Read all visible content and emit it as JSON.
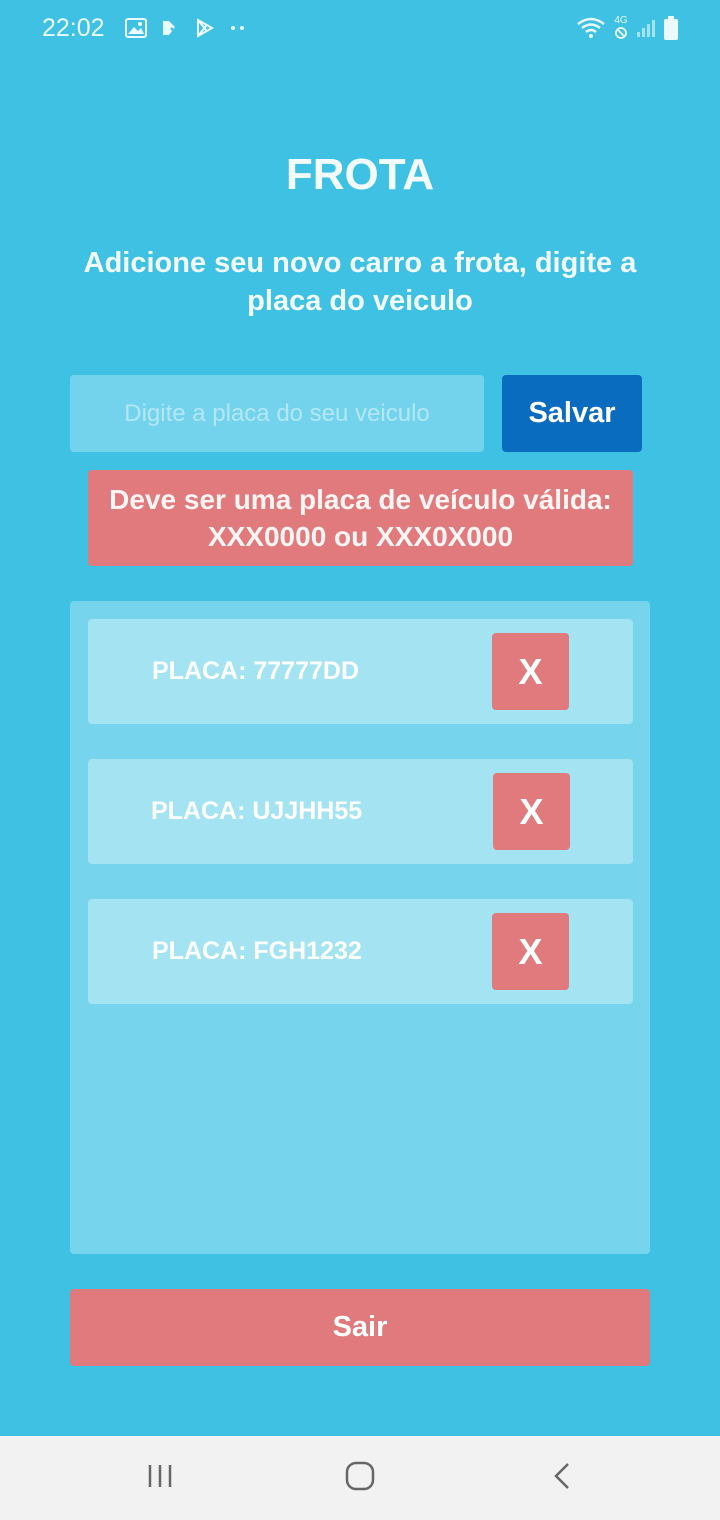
{
  "status_bar": {
    "time": "22:02",
    "left_icons": [
      "image-icon",
      "check-app-icon",
      "play-store-icon",
      "more-dots-icon"
    ],
    "right_icons": [
      "wifi-icon",
      "network-4g-icon",
      "signal-icon",
      "battery-icon"
    ],
    "network_label": "4G"
  },
  "header": {
    "title": "FROTA",
    "subtitle": "Adicione seu novo carro a frota, digite a placa do veiculo"
  },
  "form": {
    "placeholder": "Digite a placa do seu veiculo",
    "value": "",
    "save_label": "Salvar",
    "error": "Deve ser uma placa de veículo válida: XXX0000 ou XXX0X000"
  },
  "list": {
    "items": [
      {
        "label": "PLACA: 77777DD",
        "delete_label": "X"
      },
      {
        "label": "PLACA: UJJHH55",
        "delete_label": "X"
      },
      {
        "label": "PLACA: FGH1232",
        "delete_label": "X"
      }
    ]
  },
  "footer": {
    "exit_label": "Sair"
  },
  "nav": {
    "icons": [
      "recent-apps-icon",
      "home-icon",
      "back-icon"
    ]
  },
  "colors": {
    "background": "#3ec1e3",
    "panel": "#76d4ec",
    "item": "#a3e3f2",
    "danger": "#e07a7c",
    "primary": "#0a6cbf"
  }
}
